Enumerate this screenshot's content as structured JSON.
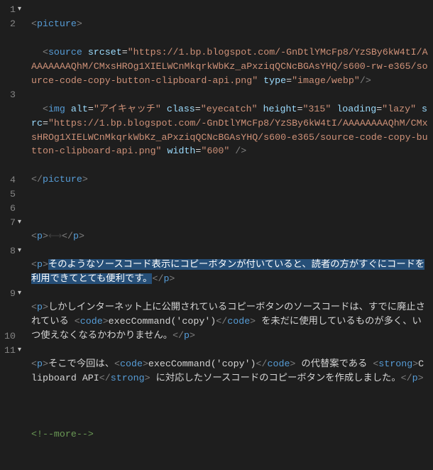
{
  "lines": [
    {
      "num": "1",
      "foldable": true
    },
    {
      "num": "2",
      "foldable": false
    },
    {
      "num": "3",
      "foldable": false
    },
    {
      "num": "4",
      "foldable": false
    },
    {
      "num": "5",
      "foldable": false
    },
    {
      "num": "6",
      "foldable": false
    },
    {
      "num": "7",
      "foldable": true
    },
    {
      "num": "8",
      "foldable": true
    },
    {
      "num": "9",
      "foldable": true
    },
    {
      "num": "10",
      "foldable": false
    },
    {
      "num": "11",
      "foldable": true
    }
  ],
  "tokens": {
    "picture_open": "picture",
    "picture_close": "picture",
    "source_tag": "source",
    "img_tag": "img",
    "p_tag": "p",
    "code_tag": "code",
    "strong_tag": "strong",
    "srcset_attr": "srcset",
    "srcset_val": "\"https://1.bp.blogspot.com/-GnDtlYMcFp8/YzSBy6kW4tI/AAAAAAAAQhM/CMxsHROg1XIELWCnMkqrkWbKz_aPxziqQCNcBGAsYHQ/s600-rw-e365/source-code-copy-button-clipboard-api.png\"",
    "type_attr": "type",
    "type_val": "\"image/webp\"",
    "alt_attr": "alt",
    "alt_val": "\"アイキャッチ\"",
    "class_attr": "class",
    "class_val": "\"eyecatch\"",
    "height_attr": "height",
    "height_val": "\"315\"",
    "loading_attr": "loading",
    "loading_val": "\"lazy\"",
    "src_attr": "src",
    "src_val": "\"https://1.bp.blogspot.com/-GnDtlYMcFp8/YzSBy6kW4tI/AAAAAAAAQhM/CMxsHROg1XIELWCnMkqrkWbKz_aPxziqQCNcBGAsYHQ/s600-e365/source-code-copy-button-clipboard-api.png\"",
    "width_attr": "width",
    "width_val": "\"600\"",
    "arrows": "⟷",
    "line7_sel": "そのようなソースコード表示にコピーボタンが付いていると、読者の方がすぐにコードを利用できてとても便利です。",
    "line8_a": "しかしインターネット上に公開されているコピーボタンのソースコードは、すでに廃止されている ",
    "line8_code": "execCommand('copy')",
    "line8_b": " を未だに使用しているものが多く、いつ使えなくなるかわかりません。",
    "line9_a": "そこで今回は、",
    "line9_code": "execCommand('copy')",
    "line9_b": " の代替案である ",
    "line9_strong": "Clipboard API",
    "line9_c": " に対応したソースコードのコピーボタンを作成しました。",
    "comment": "!--more--",
    "fold_glyph": "▾"
  }
}
